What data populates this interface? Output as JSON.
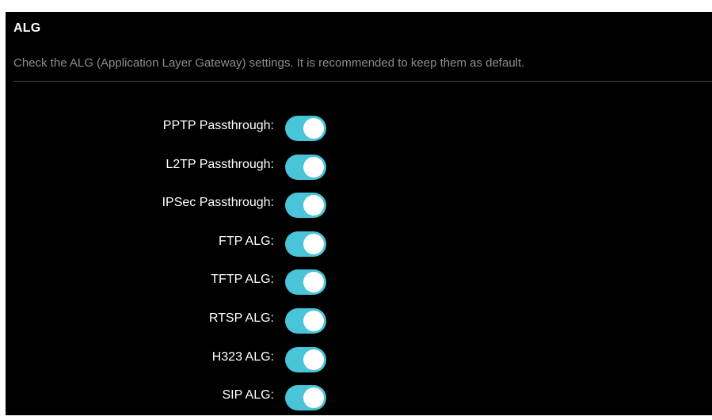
{
  "section": {
    "title": "ALG",
    "description": "Check the ALG (Application Layer Gateway) settings. It is recommended to keep them as default."
  },
  "colors": {
    "toggle_on": "#4ac4d8",
    "background": "#000000",
    "description_text": "#8d8d8d"
  },
  "settings": [
    {
      "label": "PPTP Passthrough:",
      "enabled": true
    },
    {
      "label": "L2TP Passthrough:",
      "enabled": true
    },
    {
      "label": "IPSec Passthrough:",
      "enabled": true
    },
    {
      "label": "FTP ALG:",
      "enabled": true
    },
    {
      "label": "TFTP ALG:",
      "enabled": true
    },
    {
      "label": "RTSP ALG:",
      "enabled": true
    },
    {
      "label": "H323 ALG:",
      "enabled": true
    },
    {
      "label": "SIP ALG:",
      "enabled": true
    }
  ]
}
